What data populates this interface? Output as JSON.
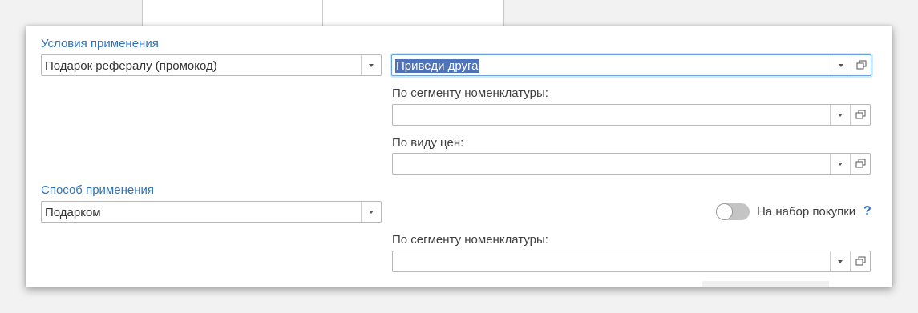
{
  "conditions": {
    "title": "Условия применения",
    "type_value": "Подарок рефералу (промокод)",
    "program_value": "Приведи друга",
    "nomenclature_segment_label": "По сегменту номенклатуры:",
    "nomenclature_segment_value": "",
    "price_type_label": "По виду цен:",
    "price_type_value": ""
  },
  "method": {
    "title": "Способ применения",
    "value": "Подарком",
    "purchase_set_label": "На набор покупки",
    "purchase_set_enabled": false,
    "help": "?",
    "nomenclature_segment_label": "По сегменту номенклатуры:",
    "nomenclature_segment_value": ""
  },
  "icons": {
    "dropdown": "chevron-down-icon",
    "open": "open-form-icon"
  },
  "colors": {
    "section_title": "#2f72b8",
    "selection": "#4e73b8",
    "focus_border": "#6ba3dc"
  }
}
